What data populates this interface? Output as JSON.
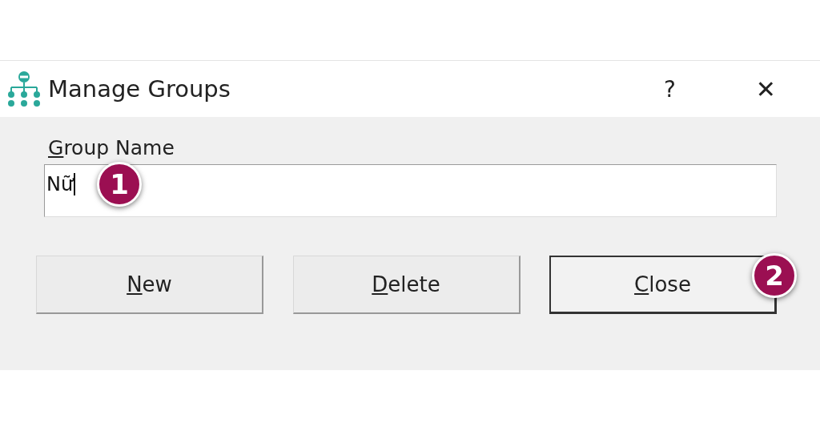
{
  "window": {
    "title": "Manage Groups",
    "help": "?",
    "close": "✕"
  },
  "field": {
    "label": "Group Name",
    "value": "Nữ",
    "focused": true,
    "callout": "1"
  },
  "buttons": [
    {
      "label": "New",
      "default": false
    },
    {
      "label": "Delete",
      "default": false
    },
    {
      "label": "Close",
      "default": true,
      "callout": "2"
    }
  ]
}
